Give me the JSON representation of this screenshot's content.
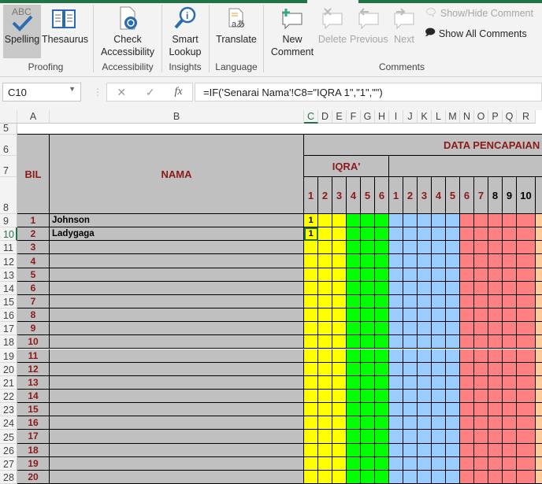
{
  "ribbon": {
    "buttons": [
      {
        "id": "spelling",
        "label": "Spelling",
        "icon": "spelling-abc-check-icon"
      },
      {
        "id": "thesaurus",
        "label": "Thesaurus",
        "icon": "book-icon"
      },
      {
        "id": "check-accessibility",
        "label": "Check Accessibility",
        "icon": "accessibility-icon"
      },
      {
        "id": "smart-lookup",
        "label": "Smart Lookup",
        "icon": "magnifier-info-icon"
      },
      {
        "id": "translate",
        "label": "Translate",
        "icon": "translate-icon"
      },
      {
        "id": "new-comment",
        "label": "New Comment",
        "icon": "new-comment-icon"
      },
      {
        "id": "delete",
        "label": "Delete",
        "icon": "delete-comment-icon"
      },
      {
        "id": "previous",
        "label": "Previous",
        "icon": "previous-comment-icon"
      },
      {
        "id": "next",
        "label": "Next",
        "icon": "next-comment-icon"
      }
    ],
    "show_hide_comment": "Show/Hide Comment",
    "show_all_comments": "Show All Comments",
    "groups": [
      "Proofing",
      "Accessibility",
      "Insights",
      "Language",
      "Comments"
    ]
  },
  "formula_bar": {
    "name_box": "C10",
    "cancel": "✕",
    "enter": "✓",
    "fx": "fx",
    "formula": "=IF('Senarai Nama'!C8=\"IQRA 1\",\"1\",\"\")"
  },
  "columns": [
    "A",
    "B",
    "C",
    "D",
    "E",
    "F",
    "G",
    "H",
    "I",
    "J",
    "K",
    "L",
    "M",
    "N",
    "O",
    "P",
    "Q",
    "R"
  ],
  "sheet": {
    "bil_header": "BIL",
    "nama_header": "NAMA",
    "data_header": "DATA PENCAPAIAN I",
    "iqra_header": "IQRA'",
    "level_numbers": [
      "1",
      "2",
      "3",
      "4",
      "5",
      "6",
      "1",
      "2",
      "3",
      "4",
      "5",
      "6",
      "7",
      "8",
      "9",
      "10"
    ],
    "rows": [
      {
        "row": "9",
        "bil": "1",
        "nama": "Johnson",
        "c": "1"
      },
      {
        "row": "10",
        "bil": "2",
        "nama": "Ladygaga",
        "c": "1"
      },
      {
        "row": "11",
        "bil": "3"
      },
      {
        "row": "12",
        "bil": "4"
      },
      {
        "row": "13",
        "bil": "5"
      },
      {
        "row": "14",
        "bil": "6"
      },
      {
        "row": "15",
        "bil": "7"
      },
      {
        "row": "16",
        "bil": "8"
      },
      {
        "row": "17",
        "bil": "9"
      },
      {
        "row": "18",
        "bil": "10"
      },
      {
        "row": "19",
        "bil": "11"
      },
      {
        "row": "20",
        "bil": "12"
      },
      {
        "row": "21",
        "bil": "13"
      },
      {
        "row": "22",
        "bil": "14"
      },
      {
        "row": "23",
        "bil": "15"
      },
      {
        "row": "24",
        "bil": "16"
      },
      {
        "row": "25",
        "bil": "17"
      },
      {
        "row": "26",
        "bil": "18"
      },
      {
        "row": "27",
        "bil": "19"
      },
      {
        "row": "28",
        "bil": "20"
      }
    ],
    "header_rows": [
      "5",
      "6",
      "7",
      "8"
    ]
  },
  "colors": {
    "accent": "#217346",
    "yellow": "#ffff00",
    "green": "#00ff00",
    "blue": "#99ccff",
    "salmon": "#ff8080",
    "peach": "#ffcc99",
    "gray": "#c0c0c0",
    "header_text": "#8b1a1a"
  }
}
